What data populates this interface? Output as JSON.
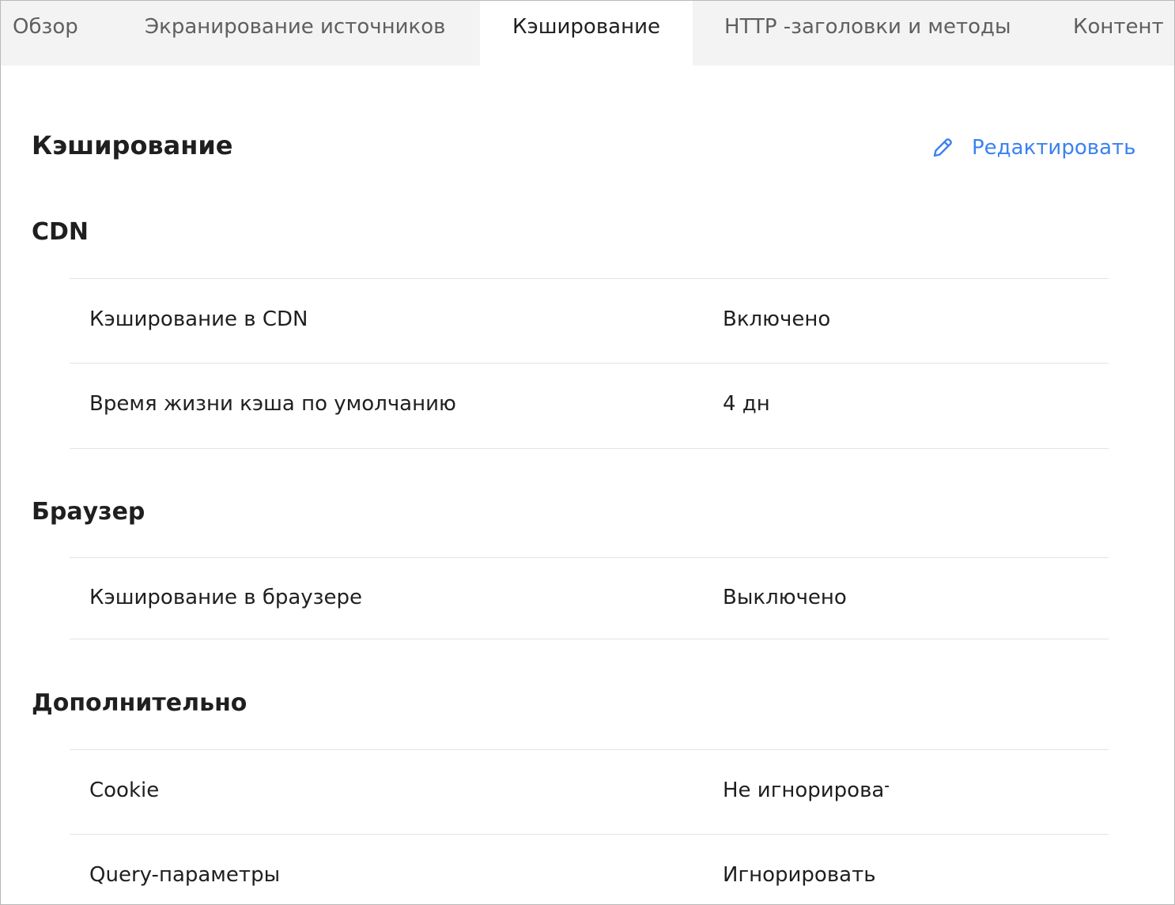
{
  "tabs": [
    {
      "label": "Обзор",
      "active": false
    },
    {
      "label": "Экранирование источников",
      "active": false
    },
    {
      "label": "Кэширование",
      "active": true
    },
    {
      "label": "HTTP -заголовки и методы",
      "active": false
    },
    {
      "label": "Контент",
      "active": false
    }
  ],
  "header": {
    "title": "Кэширование",
    "edit_label": "Редактировать",
    "edit_icon": "pencil-icon"
  },
  "sections": {
    "cdn": {
      "title": "CDN",
      "rows": [
        {
          "label": "Кэширование в CDN",
          "value": "Включено"
        },
        {
          "label": "Время жизни кэша по умолчанию",
          "value": "4 дн"
        }
      ]
    },
    "browser": {
      "title": "Браузер",
      "rows": [
        {
          "label": "Кэширование в браузере",
          "value": "Выключено"
        }
      ]
    },
    "extra": {
      "title": "Дополнительно",
      "rows": [
        {
          "label": "Cookie",
          "value": "Не игнорировать"
        },
        {
          "label": "Query-параметры",
          "value": "Игнорировать"
        }
      ]
    }
  },
  "colors": {
    "accent": "#3b82f0",
    "tabbar_bg": "#f3f3f3",
    "divider": "#e4e4e4"
  }
}
